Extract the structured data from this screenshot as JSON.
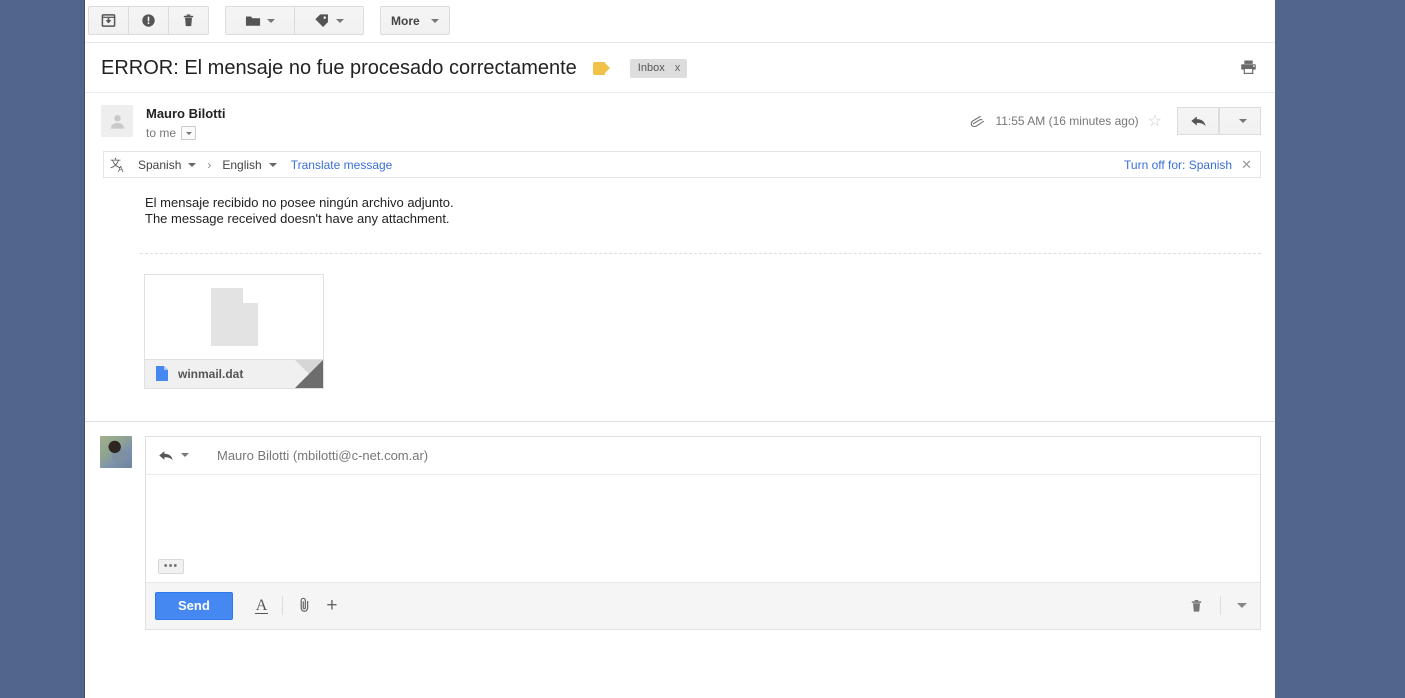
{
  "toolbar": {
    "archive_label": "Archive",
    "spam_label": "Report spam",
    "delete_label": "Delete",
    "move_label": "Move to",
    "labels_label": "Labels",
    "more_label": "More"
  },
  "message": {
    "subject": "ERROR: El mensaje no fue procesado correctamente",
    "label_chip": "Inbox",
    "label_chip_remove": "x",
    "sender_name": "Mauro Bilotti",
    "recipient": "to me",
    "timestamp": "11:55 AM (16 minutes ago)",
    "body_line_1": "El mensaje recibido no posee ningún archivo adjunto.",
    "body_line_2": "The message received doesn't have any attachment."
  },
  "translate": {
    "source_language": "Spanish",
    "target_language": "English",
    "action": "Translate message",
    "turn_off": "Turn off for: Spanish",
    "close": "✕"
  },
  "attachment": {
    "filename": "winmail.dat"
  },
  "reply": {
    "to_address": "Mauro Bilotti (mbilotti@c-net.com.ar)",
    "quoted_toggle": "•••",
    "send_label": "Send",
    "body_value": ""
  },
  "colors": {
    "desktop": "#52658a",
    "scrollbar_thumb": "#9aa9c0",
    "send_button": "#4688f1",
    "link": "#3a6fd8",
    "label_flag": "#f2c14a"
  }
}
